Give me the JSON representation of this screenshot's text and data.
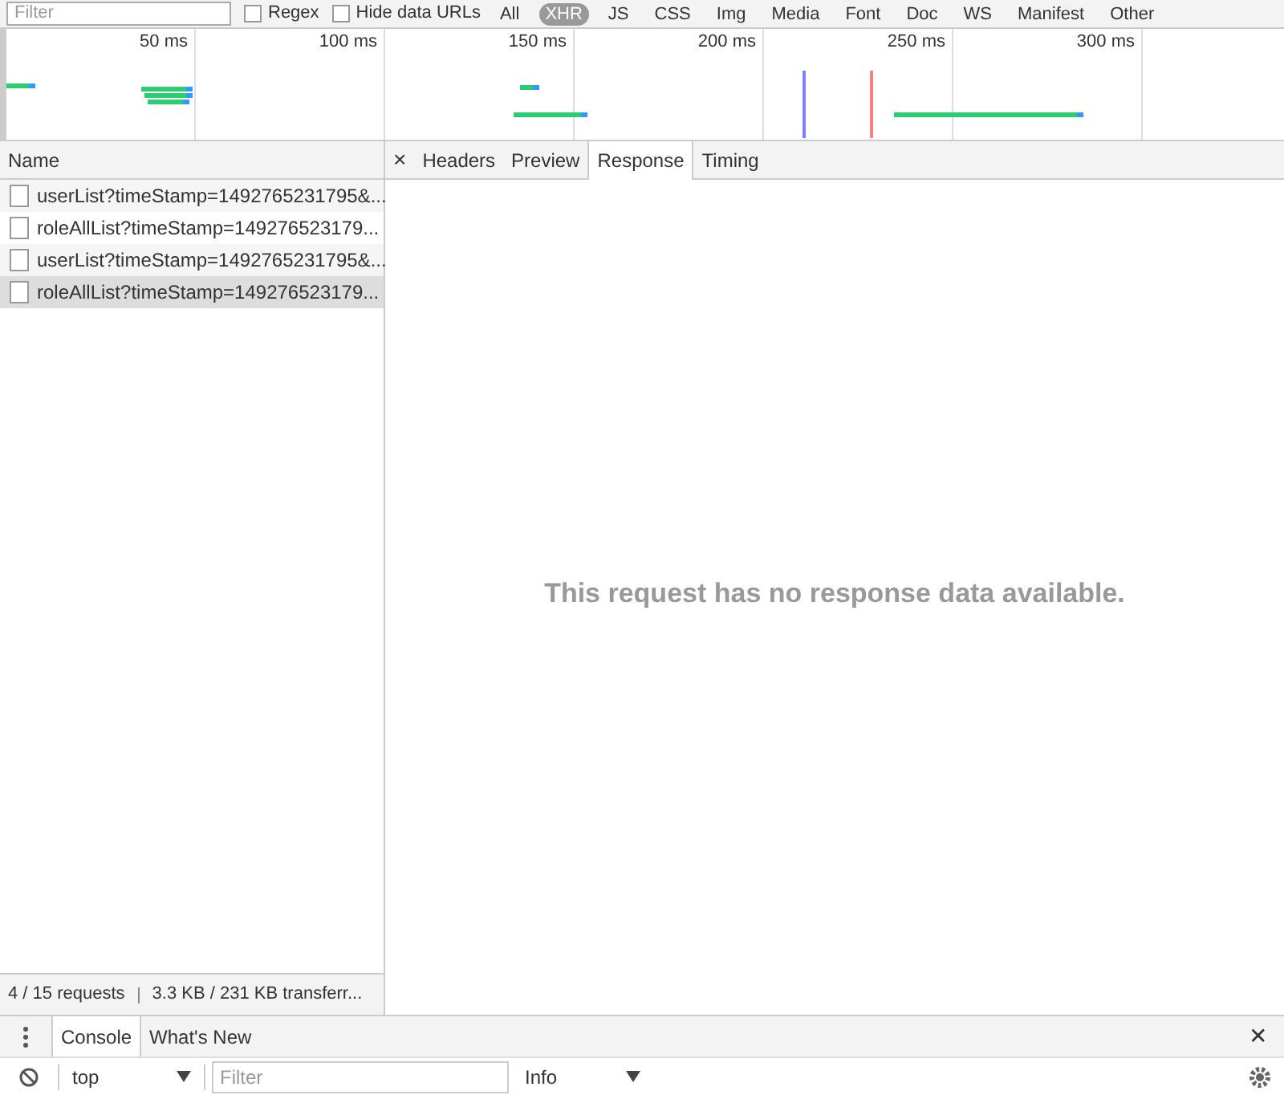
{
  "filter_bar": {
    "placeholder": "Filter",
    "regex": {
      "label": "Regex",
      "checked": false
    },
    "hide_data_urls": {
      "label": "Hide data URLs",
      "checked": false
    },
    "types": [
      {
        "label": "All",
        "selected": false
      },
      {
        "label": "XHR",
        "selected": true
      },
      {
        "label": "JS",
        "selected": false
      },
      {
        "label": "CSS",
        "selected": false
      },
      {
        "label": "Img",
        "selected": false
      },
      {
        "label": "Media",
        "selected": false
      },
      {
        "label": "Font",
        "selected": false
      },
      {
        "label": "Doc",
        "selected": false
      },
      {
        "label": "WS",
        "selected": false
      },
      {
        "label": "Manifest",
        "selected": false
      },
      {
        "label": "Other",
        "selected": false
      }
    ]
  },
  "timeline": {
    "ticks": [
      "50 ms",
      "100 ms",
      "150 ms",
      "200 ms",
      "250 ms",
      "300 ms"
    ]
  },
  "requests": {
    "column": "Name",
    "rows": [
      {
        "name": "userList?timeStamp=1492765231795&...",
        "selected": false
      },
      {
        "name": "roleAllList?timeStamp=149276523179...",
        "selected": false
      },
      {
        "name": "userList?timeStamp=1492765231795&...",
        "selected": false
      },
      {
        "name": "roleAllList?timeStamp=149276523179...",
        "selected": true
      }
    ],
    "summary": "4 / 15 requests",
    "transferred": "3.3 KB / 231 KB transferr..."
  },
  "detail": {
    "close": "×",
    "tabs": [
      {
        "label": "Headers",
        "selected": false
      },
      {
        "label": "Preview",
        "selected": false
      },
      {
        "label": "Response",
        "selected": true
      },
      {
        "label": "Timing",
        "selected": false
      }
    ],
    "message": "This request has no response data available."
  },
  "drawer": {
    "tabs": [
      {
        "label": "Console",
        "selected": true
      },
      {
        "label": "What's New",
        "selected": false
      }
    ],
    "close": "✕",
    "context": "top",
    "filter_placeholder": "Filter",
    "level": "Info"
  }
}
